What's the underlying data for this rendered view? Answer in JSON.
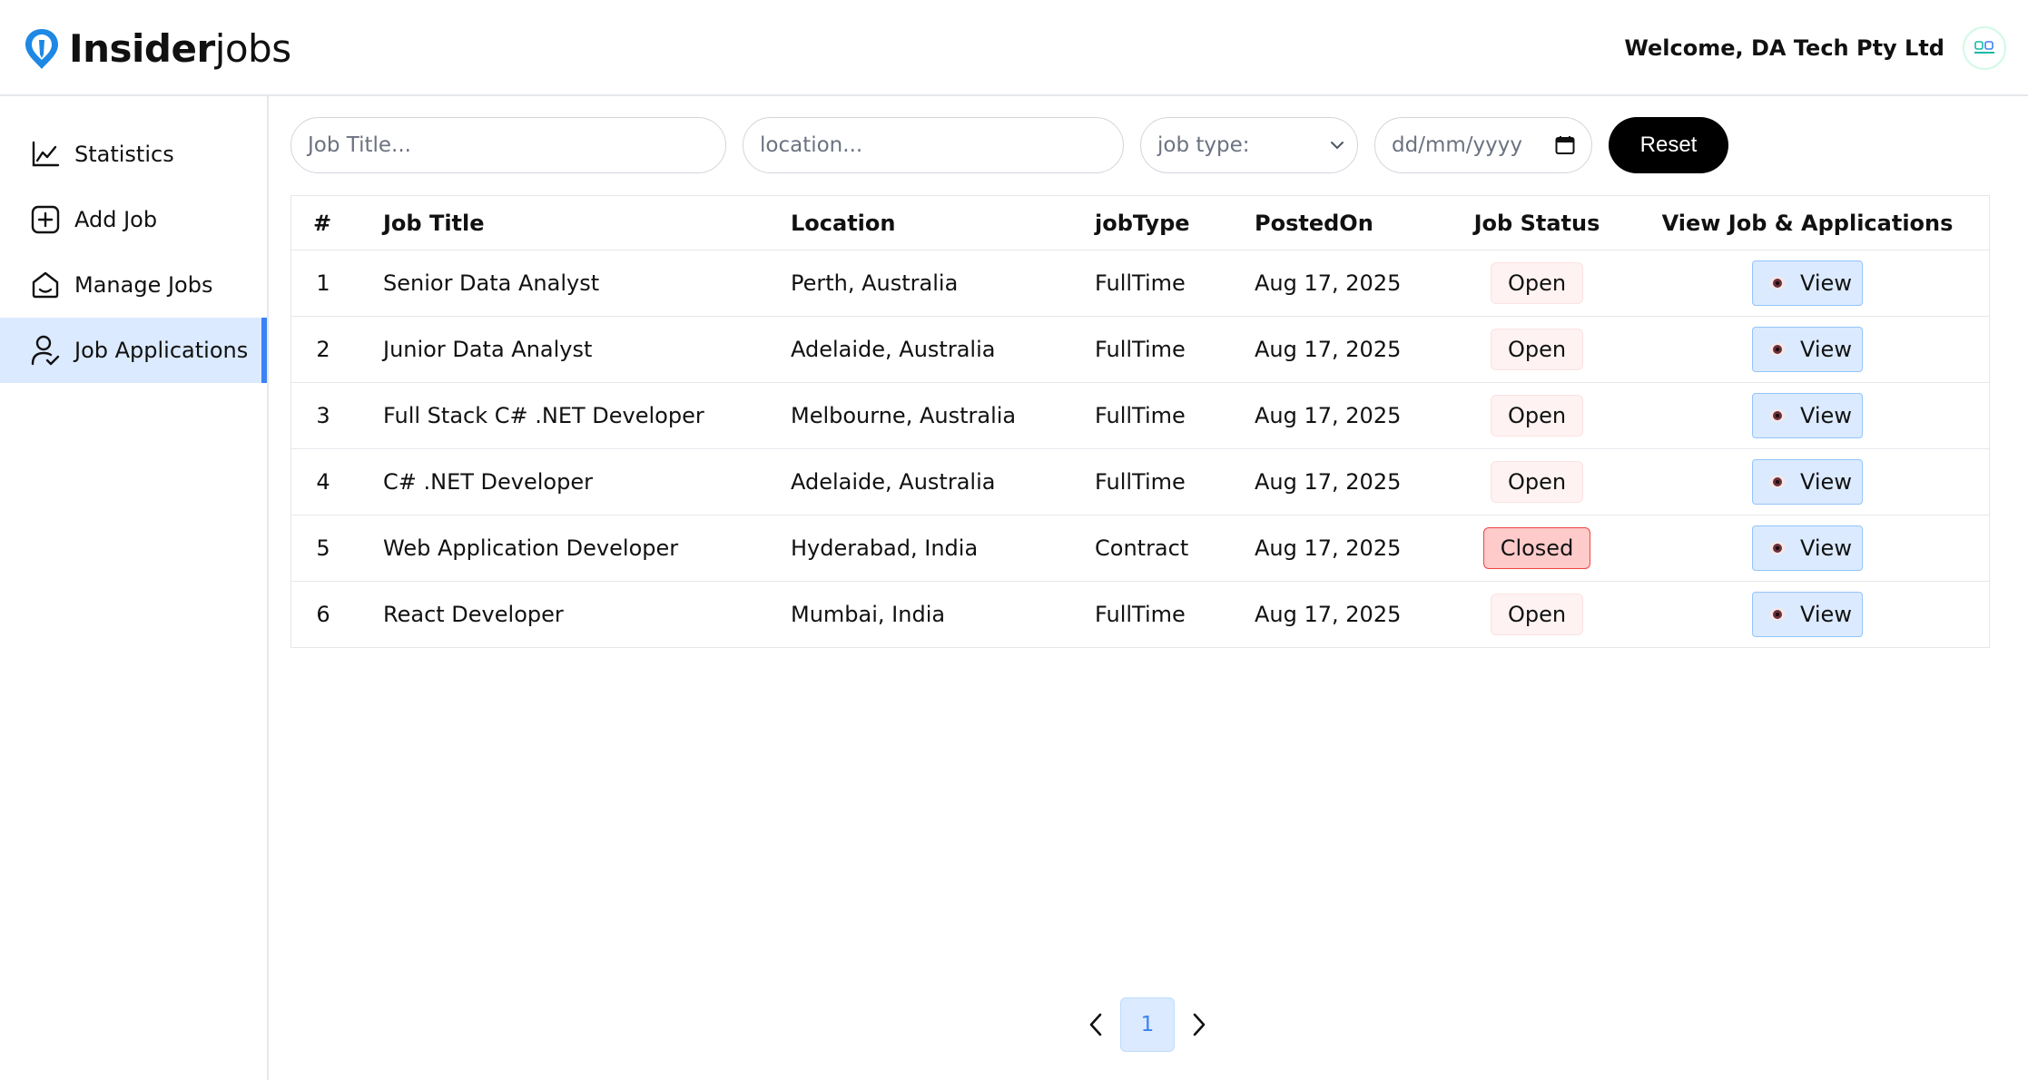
{
  "header": {
    "logo_bold": "Insider",
    "logo_light": "jobs",
    "welcome": "Welcome, DA Tech Pty Ltd"
  },
  "sidebar": {
    "items": [
      {
        "label": "Statistics",
        "icon": "chart-line-icon"
      },
      {
        "label": "Add Job",
        "icon": "plus-square-icon"
      },
      {
        "label": "Manage Jobs",
        "icon": "briefcase-icon"
      },
      {
        "label": "Job Applications",
        "icon": "user-check-icon",
        "active": true
      }
    ]
  },
  "filters": {
    "title_placeholder": "Job Title...",
    "location_placeholder": "location...",
    "job_type_value": "job type:",
    "date_placeholder": "dd/mm/yyyy",
    "reset_label": "Reset"
  },
  "table": {
    "headers": [
      "#",
      "Job Title",
      "Location",
      "jobType",
      "PostedOn",
      "Job Status",
      "View Job & Applications"
    ],
    "rows": [
      {
        "num": "1",
        "title": "Senior Data Analyst",
        "location": "Perth, Australia",
        "type": "FullTime",
        "posted": "Aug 17, 2025",
        "status": "Open",
        "action": "View"
      },
      {
        "num": "2",
        "title": "Junior Data Analyst",
        "location": "Adelaide, Australia",
        "type": "FullTime",
        "posted": "Aug 17, 2025",
        "status": "Open",
        "action": "View"
      },
      {
        "num": "3",
        "title": "Full Stack C# .NET Developer",
        "location": "Melbourne, Australia",
        "type": "FullTime",
        "posted": "Aug 17, 2025",
        "status": "Open",
        "action": "View"
      },
      {
        "num": "4",
        "title": "C# .NET Developer",
        "location": "Adelaide, Australia",
        "type": "FullTime",
        "posted": "Aug 17, 2025",
        "status": "Open",
        "action": "View"
      },
      {
        "num": "5",
        "title": "Web Application Developer",
        "location": "Hyderabad, India",
        "type": "Contract",
        "posted": "Aug 17, 2025",
        "status": "Closed",
        "action": "View"
      },
      {
        "num": "6",
        "title": "React Developer",
        "location": "Mumbai, India",
        "type": "FullTime",
        "posted": "Aug 17, 2025",
        "status": "Open",
        "action": "View"
      }
    ]
  },
  "pagination": {
    "current": "1"
  },
  "colors": {
    "accent": "#3b82f6",
    "active_bg": "#dbeafe",
    "closed_bg": "#fecaca",
    "open_bg": "#fef2f2"
  }
}
